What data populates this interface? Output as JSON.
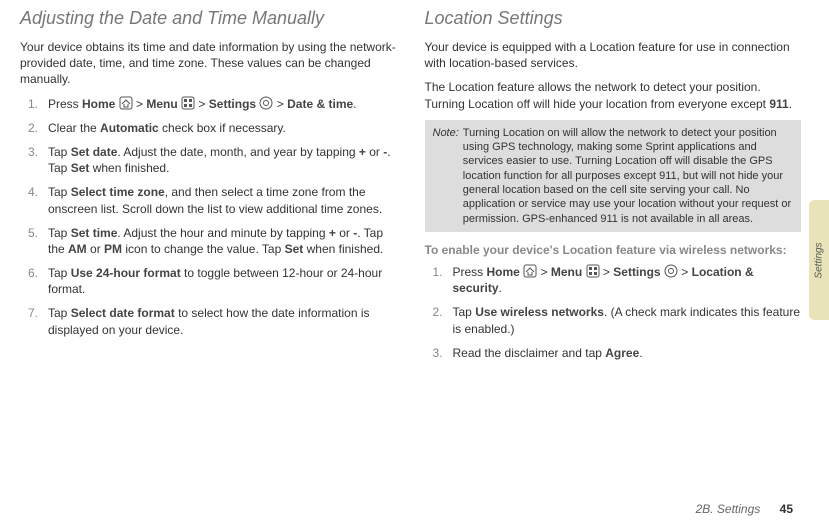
{
  "left": {
    "heading": "Adjusting the Date and Time Manually",
    "intro": "Your device obtains its time and date information by using the network-provided date, time, and time zone. These values can be changed manually.",
    "steps": {
      "s1a": "Press ",
      "s1_home": "Home",
      "s1b": " > ",
      "s1_menu": "Menu",
      "s1c": " > ",
      "s1_settings": "Settings",
      "s1d": " > ",
      "s1_dt": "Date & time",
      "s1e": ".",
      "s2a": "Clear the ",
      "s2_auto": "Automatic",
      "s2b": " check box if necessary.",
      "s3a": "Tap ",
      "s3_sd": "Set date",
      "s3b": ". Adjust the date, month, and year by tapping ",
      "s3_plus": "+",
      "s3c": " or ",
      "s3_minus": "-",
      "s3d": ". Tap ",
      "s3_set": "Set",
      "s3e": " when finished.",
      "s4a": "Tap ",
      "s4_stz": "Select time zone",
      "s4b": ", and then select a time zone from the onscreen list. Scroll down the list to view additional time zones.",
      "s5a": "Tap ",
      "s5_st": "Set time",
      "s5b": ". Adjust the hour and minute by tapping ",
      "s5_plus": "+",
      "s5c": " or ",
      "s5_minus": "-",
      "s5d": ". Tap the ",
      "s5_am": "AM",
      "s5e": " or ",
      "s5_pm": "PM",
      "s5f": " icon to change the value. Tap ",
      "s5_set": "Set",
      "s5g": " when finished.",
      "s6a": "Tap ",
      "s6_u24": "Use 24-hour format",
      "s6b": " to toggle between 12-hour or 24-hour format.",
      "s7a": "Tap ",
      "s7_sdf": "Select date format",
      "s7b": " to select how the date information is displayed on your device."
    }
  },
  "right": {
    "heading": "Location Settings",
    "p1": "Your device is equipped with a Location feature for use in connection with location-based services.",
    "p2a": "The Location feature allows the network to detect your position. Turning Location off will hide your location from everyone except ",
    "p2_911": "911",
    "p2b": ".",
    "note_label": "Note:",
    "note": "Turning Location on will allow the network to detect your position using GPS technology, making some Sprint applications and services easier to use. Turning Location off will disable the GPS location function for all purposes except 911, but will not hide your general location based on the cell site serving your call. No application or service may use your location without your request or permission. GPS-enhanced 911 is not available in all areas.",
    "lead": "To enable your device's Location feature via wireless networks:",
    "steps": {
      "s1a": "Press ",
      "s1_home": "Home",
      "s1b": " > ",
      "s1_menu": "Menu",
      "s1c": " > ",
      "s1_settings": "Settings",
      "s1d": " > ",
      "s1_ls": "Location & security",
      "s1e": ".",
      "s2a": "Tap ",
      "s2_uwn": "Use wireless networks",
      "s2b": ". (A check mark indicates this feature is enabled.)",
      "s3a": "Read the disclaimer and tap ",
      "s3_agree": "Agree",
      "s3b": "."
    }
  },
  "footer_section": "2B. Settings",
  "footer_page": "45",
  "tab": "Settings"
}
